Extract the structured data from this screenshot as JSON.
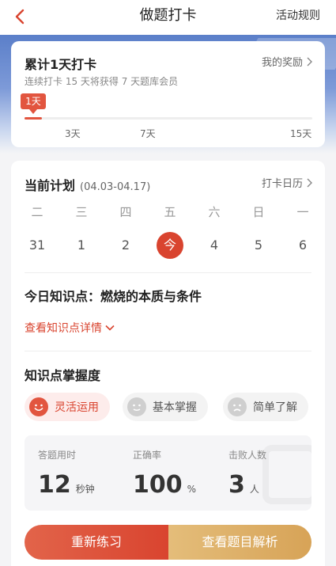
{
  "nav": {
    "title": "做题打卡",
    "rules_label": "活动规则"
  },
  "streak": {
    "title": "累计1天打卡",
    "reward_label": "我的奖励",
    "subtitle": "连续打卡 15 天将获得 7 天题库会员",
    "current_badge": "1天",
    "progress_fraction": 0.06,
    "milestones": [
      "3天",
      "7天",
      "15天"
    ]
  },
  "plan": {
    "title": "当前计划",
    "range": "(04.03-04.17)",
    "calendar_label": "打卡日历",
    "weekdays": [
      "二",
      "三",
      "四",
      "五",
      "六",
      "日",
      "一"
    ],
    "dates": [
      "31",
      "1",
      "2",
      "今",
      "4",
      "5",
      "6"
    ],
    "today_index": 3
  },
  "knowledge": {
    "title": "今日知识点：燃烧的本质与条件",
    "detail_link": "查看知识点详情"
  },
  "mastery": {
    "title": "知识点掌握度",
    "options": [
      {
        "label": "灵活运用",
        "active": true
      },
      {
        "label": "基本掌握",
        "active": false
      },
      {
        "label": "简单了解",
        "active": false
      }
    ]
  },
  "stats": {
    "time_label": "答题用时",
    "time_value": "12",
    "time_unit": "秒钟",
    "accuracy_label": "正确率",
    "accuracy_value": "100",
    "accuracy_unit": "%",
    "beat_label": "击败人数",
    "beat_value": "3",
    "beat_unit": "人"
  },
  "actions": {
    "retry_label": "重新练习",
    "analysis_label": "查看题目解析"
  },
  "colors": {
    "accent": "#d9442f",
    "gold": "#d7a357",
    "banner": "#5b7fc9"
  }
}
